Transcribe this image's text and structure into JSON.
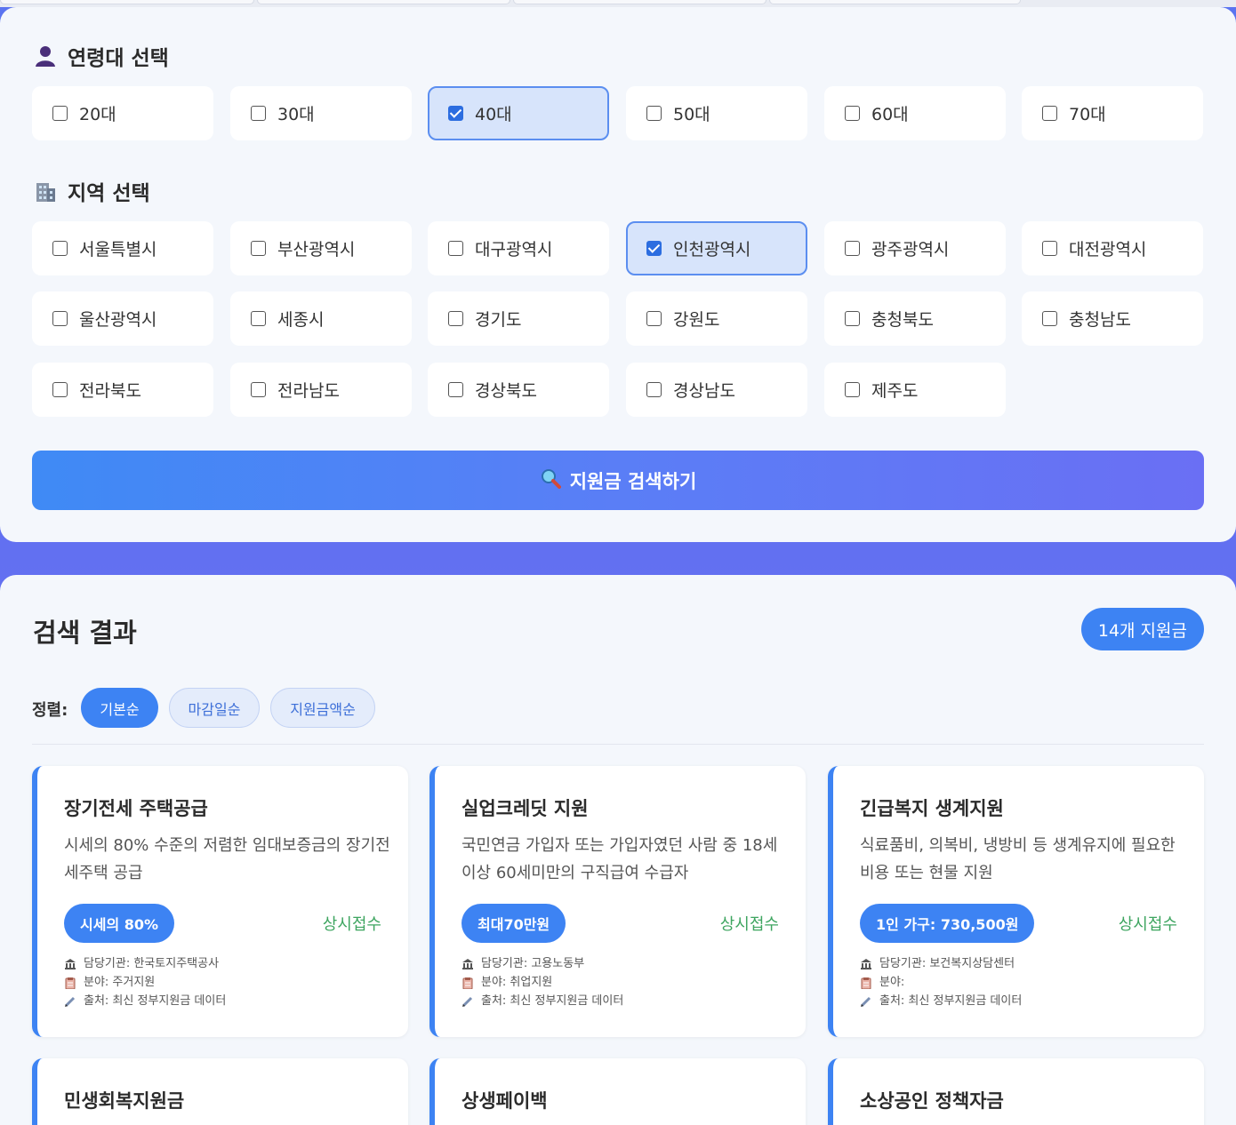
{
  "age_section": {
    "title": "연령대 선택",
    "icon": "person-icon",
    "options": [
      {
        "label": "20대",
        "checked": false
      },
      {
        "label": "30대",
        "checked": false
      },
      {
        "label": "40대",
        "checked": true
      },
      {
        "label": "50대",
        "checked": false
      },
      {
        "label": "60대",
        "checked": false
      },
      {
        "label": "70대",
        "checked": false
      }
    ]
  },
  "region_section": {
    "title": "지역 선택",
    "icon": "building-icon",
    "options": [
      {
        "label": "서울특별시",
        "checked": false
      },
      {
        "label": "부산광역시",
        "checked": false
      },
      {
        "label": "대구광역시",
        "checked": false
      },
      {
        "label": "인천광역시",
        "checked": true
      },
      {
        "label": "광주광역시",
        "checked": false
      },
      {
        "label": "대전광역시",
        "checked": false
      },
      {
        "label": "울산광역시",
        "checked": false
      },
      {
        "label": "세종시",
        "checked": false
      },
      {
        "label": "경기도",
        "checked": false
      },
      {
        "label": "강원도",
        "checked": false
      },
      {
        "label": "충청북도",
        "checked": false
      },
      {
        "label": "충청남도",
        "checked": false
      },
      {
        "label": "전라북도",
        "checked": false
      },
      {
        "label": "전라남도",
        "checked": false
      },
      {
        "label": "경상북도",
        "checked": false
      },
      {
        "label": "경상남도",
        "checked": false
      },
      {
        "label": "제주도",
        "checked": false
      }
    ]
  },
  "search_button": {
    "label": "지원금 검색하기",
    "icon": "magnifier-icon"
  },
  "results": {
    "title": "검색 결과",
    "count_label": "14개 지원금",
    "sort_label": "정렬:",
    "sort_options": [
      {
        "label": "기본순",
        "active": true
      },
      {
        "label": "마감일순",
        "active": false
      },
      {
        "label": "지원금액순",
        "active": false
      }
    ],
    "cards": [
      {
        "title": "장기전세 주택공급",
        "desc": "시세의 80% 수준의 저렴한 임대보증금의 장기전세주택 공급",
        "amount": "시세의 80%",
        "status": "상시접수",
        "agency": "담당기관: 한국토지주택공사",
        "field": "분야: 주거지원",
        "source": "출처: 최신 정부지원금 데이터"
      },
      {
        "title": "실업크레딧 지원",
        "desc": "국민연금 가입자 또는 가입자였던 사람 중 18세이상 60세미만의 구직급여 수급자",
        "amount": "최대70만원",
        "status": "상시접수",
        "agency": "담당기관: 고용노동부",
        "field": "분야: 취업지원",
        "source": "출처: 최신 정부지원금 데이터"
      },
      {
        "title": "긴급복지 생계지원",
        "desc": "식료품비, 의복비, 냉방비 등 생계유지에 필요한 비용 또는 현물 지원",
        "amount": "1인 가구: 730,500원",
        "status": "상시접수",
        "agency": "담당기관: 보건복지상담센터",
        "field": "분야:",
        "source": "출처: 최신 정부지원금 데이터"
      },
      {
        "title": "민생회복지원금"
      },
      {
        "title": "상생페이백"
      },
      {
        "title": "소상공인 정책자금"
      }
    ]
  },
  "colors": {
    "accent": "#3d83f3",
    "status_green": "#3ea560",
    "panel_bg": "#f4f7fc"
  }
}
